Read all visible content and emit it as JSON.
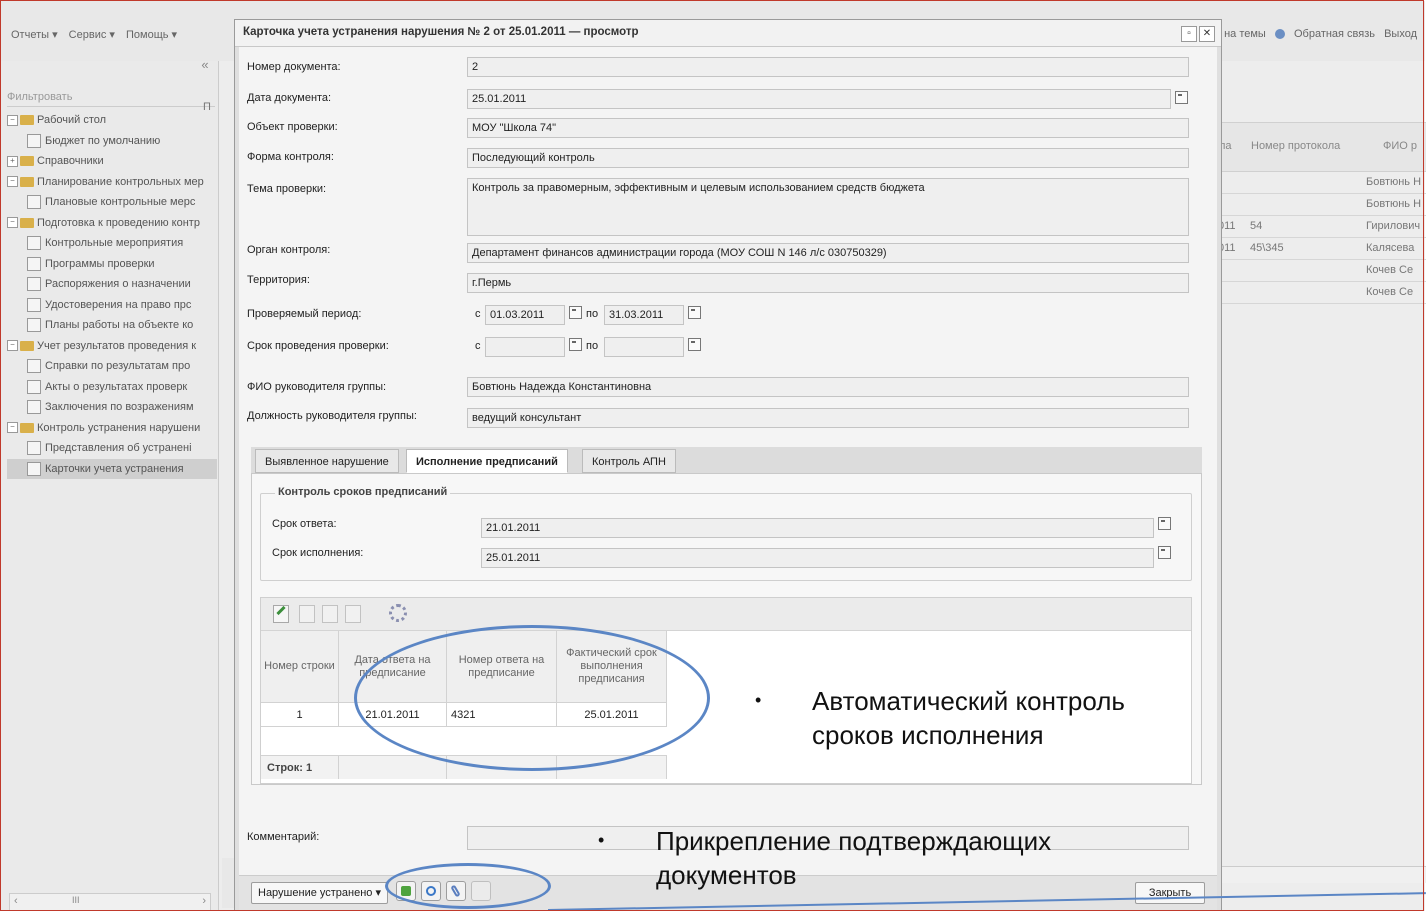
{
  "menubar": {
    "left": [
      "Отчеты ▾",
      "Сервис ▾",
      "Помощь ▾"
    ],
    "right_themes": "на темы",
    "right_feedback": "Обратная связь",
    "right_exit": "Выход"
  },
  "left_panel": {
    "filter_placeholder": "Фильтровать",
    "collapse": "«",
    "tree": [
      {
        "label": "Рабочий стол",
        "level": 0,
        "exp": "−"
      },
      {
        "label": "Бюджет по умолчанию",
        "level": 1
      },
      {
        "label": "Справочники",
        "level": 0,
        "exp": "+"
      },
      {
        "label": "Планирование контрольных мер",
        "level": 0,
        "exp": "−"
      },
      {
        "label": "Плановые контрольные мерс",
        "level": 1
      },
      {
        "label": "Подготовка к проведению контр",
        "level": 0,
        "exp": "−"
      },
      {
        "label": "Контрольные мероприятия",
        "level": 1
      },
      {
        "label": "Программы проверки",
        "level": 1
      },
      {
        "label": "Распоряжения о назначении",
        "level": 1
      },
      {
        "label": "Удостоверения на право прс",
        "level": 1
      },
      {
        "label": "Планы работы на объекте ко",
        "level": 1
      },
      {
        "label": "Учет результатов проведения к",
        "level": 0,
        "exp": "−"
      },
      {
        "label": "Справки по результатам про",
        "level": 1
      },
      {
        "label": "Акты о результатах проверк",
        "level": 1
      },
      {
        "label": "Заключения по возражениям",
        "level": 1
      },
      {
        "label": "Контроль устранения нарушени",
        "level": 0,
        "exp": "−"
      },
      {
        "label": "Представления об устранені",
        "level": 1
      },
      {
        "label": "Карточки учета устранения",
        "level": 1,
        "selected": true
      }
    ],
    "scroll_label": "III"
  },
  "bg_grid": {
    "headers": [
      "ла",
      "Номер протокола",
      "ФИО р"
    ],
    "rows": [
      [
        "",
        "",
        "Бовтюнь Н"
      ],
      [
        "",
        "",
        "Бовтюнь Н"
      ],
      [
        "011",
        "54",
        "Гирилович"
      ],
      [
        "011",
        "45\\345",
        "Калясева"
      ],
      [
        "",
        "",
        "Кочев Се"
      ],
      [
        "",
        "",
        "Кочев Се"
      ]
    ],
    "side_letter": "П"
  },
  "dialog": {
    "title": "Карточка учета устранения нарушения № 2 от 25.01.2011 — просмотр",
    "fields": {
      "doc_number_label": "Номер документа:",
      "doc_number": "2",
      "doc_date_label": "Дата документа:",
      "doc_date": "25.01.2011",
      "object_label": "Объект проверки:",
      "object": "МОУ \"Школа  74\"",
      "form_label": "Форма контроля:",
      "form": "Последующий контроль",
      "topic_label": "Тема проверки:",
      "topic": "Контроль за правомерным, эффективным и целевым использованием средств бюджета",
      "organ_label": "Орган контроля:",
      "organ": "Департамент финансов администрации города (МОУ СОШ N 146 л/с 030750329)",
      "territory_label": "Территория:",
      "territory": "г.Пермь",
      "period_label": "Проверяемый период:",
      "period_from_label": "с",
      "period_from": "01.03.2011",
      "period_to_label": "по",
      "period_to": "31.03.2011",
      "duration_label": "Срок проведения проверки:",
      "duration_from_label": "с",
      "duration_from": "",
      "duration_to_label": "по",
      "duration_to": "",
      "head_label": "ФИО руководителя группы:",
      "head": "Бовтюнь Надежда Константиновна",
      "position_label": "Должность руководителя группы:",
      "position": "ведущий консультант"
    },
    "tabs": [
      "Выявленное нарушение",
      "Исполнение предписаний",
      "Контроль АПН"
    ],
    "fieldset": {
      "legend": "Контроль сроков предписаний",
      "answer_deadline_label": "Срок ответа:",
      "answer_deadline": "21.01.2011",
      "exec_deadline_label": "Срок исполнения:",
      "exec_deadline": "25.01.2011"
    },
    "grid": {
      "headers": [
        "Номер строки",
        "Дата ответа на предписание",
        "Номер ответа на предписание",
        "Фактический срок выполнения предписания"
      ],
      "rows": [
        [
          "1",
          "21.01.2011",
          "4321",
          "25.01.2011"
        ]
      ],
      "footer": "Строк: 1"
    },
    "comment_label": "Комментарий:",
    "comment": "",
    "footer": {
      "status_button": "Нарушение устранено ▾",
      "close_button": "Закрыть"
    }
  },
  "annotations": {
    "bullet": "•",
    "callout1_line1": "Автоматический контроль",
    "callout1_line2": "сроков исполнения",
    "callout2_line1": "Прикрепление подтверждающих",
    "callout2_line2": "документов",
    "accent": "#5b86c5"
  }
}
